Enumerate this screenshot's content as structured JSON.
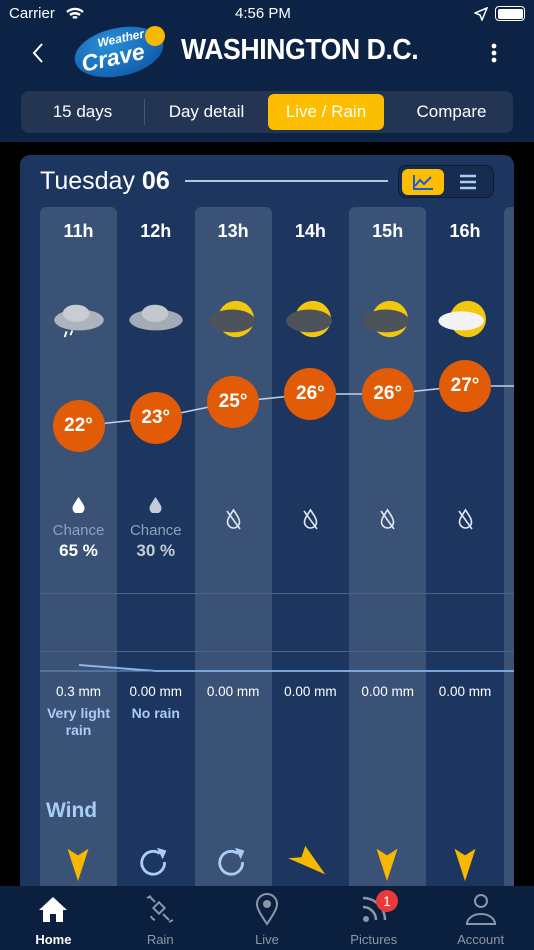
{
  "status": {
    "carrier": "Carrier",
    "time": "4:56 PM"
  },
  "header": {
    "title": "WASHINGTON D.C.",
    "logo_top": "Weather",
    "logo_bottom": "Crave"
  },
  "tabs": [
    {
      "label": "15 days"
    },
    {
      "label": "Day detail"
    },
    {
      "label": "Live / Rain",
      "active": true
    },
    {
      "label": "Compare"
    }
  ],
  "day": {
    "name": "Tuesday",
    "num": "06",
    "view": "graph"
  },
  "hours": [
    {
      "hour": "11h",
      "icon": "cloud-rain",
      "temp": 22,
      "temp_label": "22°",
      "chance_label": "Chance",
      "chance": "65 %",
      "rain": "0.3 mm",
      "desc": "Very light rain",
      "wind": "arrow-down"
    },
    {
      "hour": "12h",
      "icon": "cloud",
      "temp": 23,
      "temp_label": "23°",
      "chance_label": "Chance",
      "chance": "30 %",
      "rain": "0.00 mm",
      "desc": "No rain",
      "wind": "variable"
    },
    {
      "hour": "13h",
      "icon": "sun-cloud-dark",
      "temp": 25,
      "temp_label": "25°",
      "rain": "0.00 mm",
      "wind": "variable"
    },
    {
      "hour": "14h",
      "icon": "sun-cloud-dark",
      "temp": 26,
      "temp_label": "26°",
      "rain": "0.00 mm",
      "wind": "arrow-down-right"
    },
    {
      "hour": "15h",
      "icon": "sun-cloud-dark",
      "temp": 26,
      "temp_label": "26°",
      "rain": "0.00 mm",
      "wind": "arrow-down"
    },
    {
      "hour": "16h",
      "icon": "sun-cloud-light",
      "temp": 27,
      "temp_label": "27°",
      "rain": "0.00 mm",
      "wind": "arrow-down"
    }
  ],
  "wind_label": "Wind",
  "nav": [
    {
      "label": "Home",
      "icon": "home-icon",
      "active": true
    },
    {
      "label": "Rain",
      "icon": "satellite-icon"
    },
    {
      "label": "Live",
      "icon": "location-pin-icon"
    },
    {
      "label": "Pictures",
      "icon": "feed-icon",
      "badge": "1"
    },
    {
      "label": "Account",
      "icon": "user-icon"
    }
  ],
  "colors": {
    "accent": "#fdbd00",
    "temp": "#e25c07",
    "header": "#0c2345"
  }
}
